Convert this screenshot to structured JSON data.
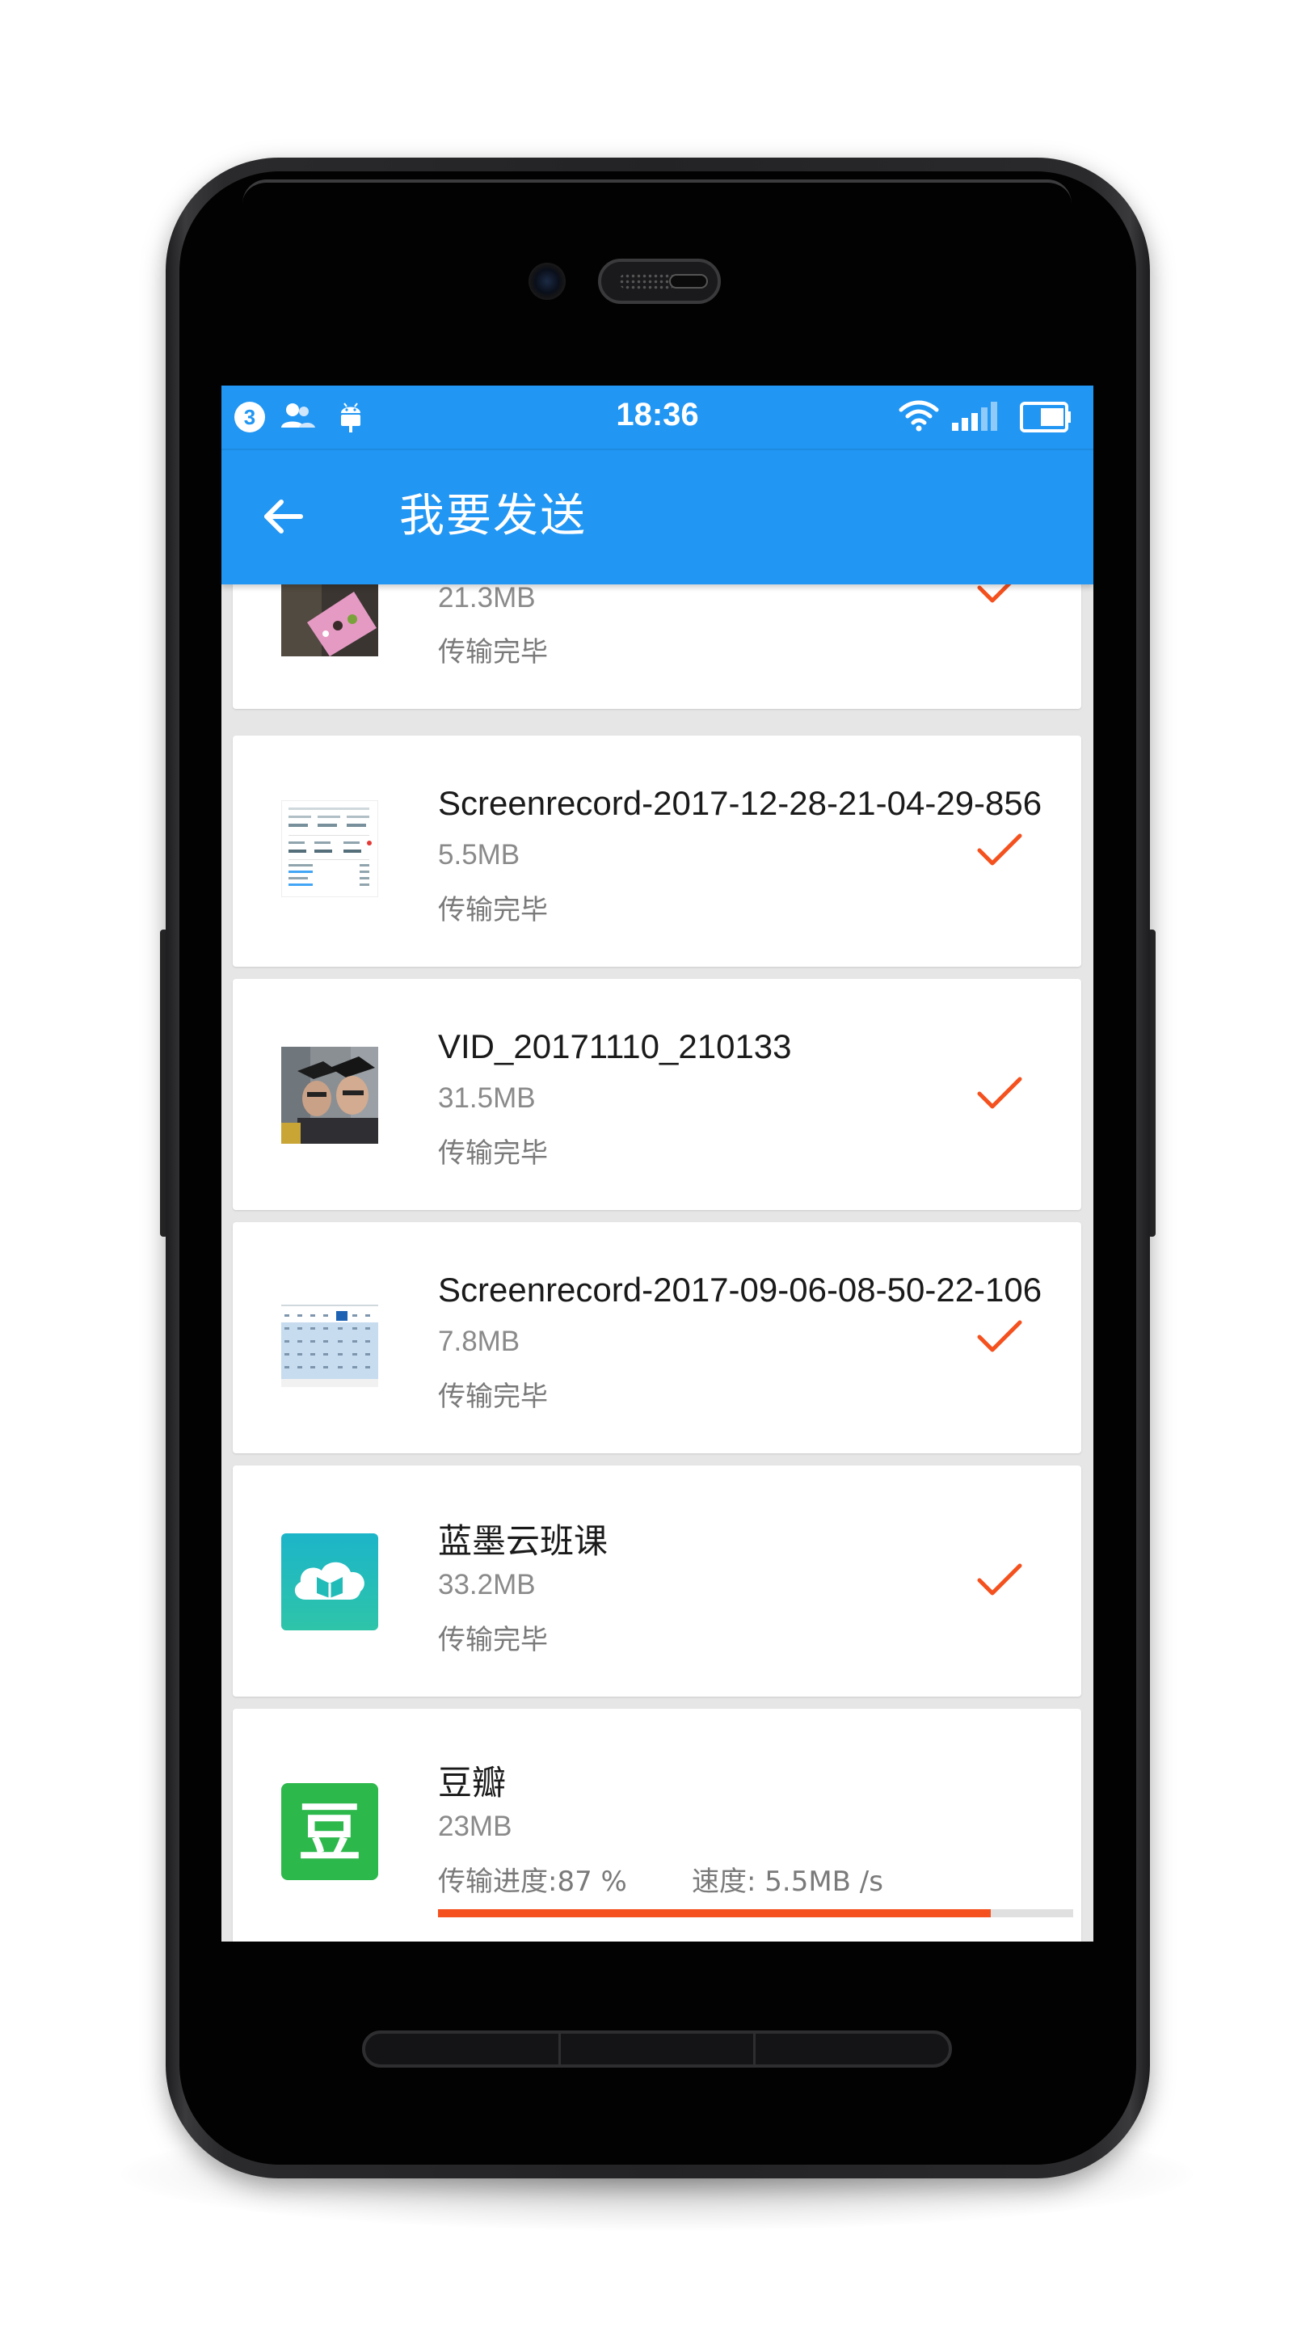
{
  "status_bar": {
    "notification_count": "3",
    "time": "18:36"
  },
  "header": {
    "title": "我要发送"
  },
  "colors": {
    "primary": "#2196f3",
    "accent": "#f4511e",
    "check": "#f4511e"
  },
  "transfers": [
    {
      "name": "",
      "size": "21.3MB",
      "status": "传输完毕",
      "done": true,
      "thumb": "photo-thumbnail"
    },
    {
      "name": "Screenrecord-2017-12-28-21-04-29-856",
      "size": "5.5MB",
      "status": "传输完毕",
      "done": true,
      "thumb": "screenshot-thumbnail"
    },
    {
      "name": "VID_20171110_210133",
      "size": "31.5MB",
      "status": "传输完毕",
      "done": true,
      "thumb": "video-thumbnail"
    },
    {
      "name": "Screenrecord-2017-09-06-08-50-22-106",
      "size": "7.8MB",
      "status": "传输完毕",
      "done": true,
      "thumb": "calendar-screenshot-thumbnail"
    },
    {
      "name": "蓝墨云班课",
      "size": "33.2MB",
      "status": "传输完毕",
      "done": true,
      "thumb": "cloud-book-app-icon"
    },
    {
      "name": "豆瓣",
      "size": "23MB",
      "progress_text": "传输进度:87 %",
      "speed_text": "速度: 5.5MB /s",
      "progress": 0.87,
      "done": false,
      "thumb": "douban-app-icon",
      "thumb_glyph": "豆"
    }
  ]
}
